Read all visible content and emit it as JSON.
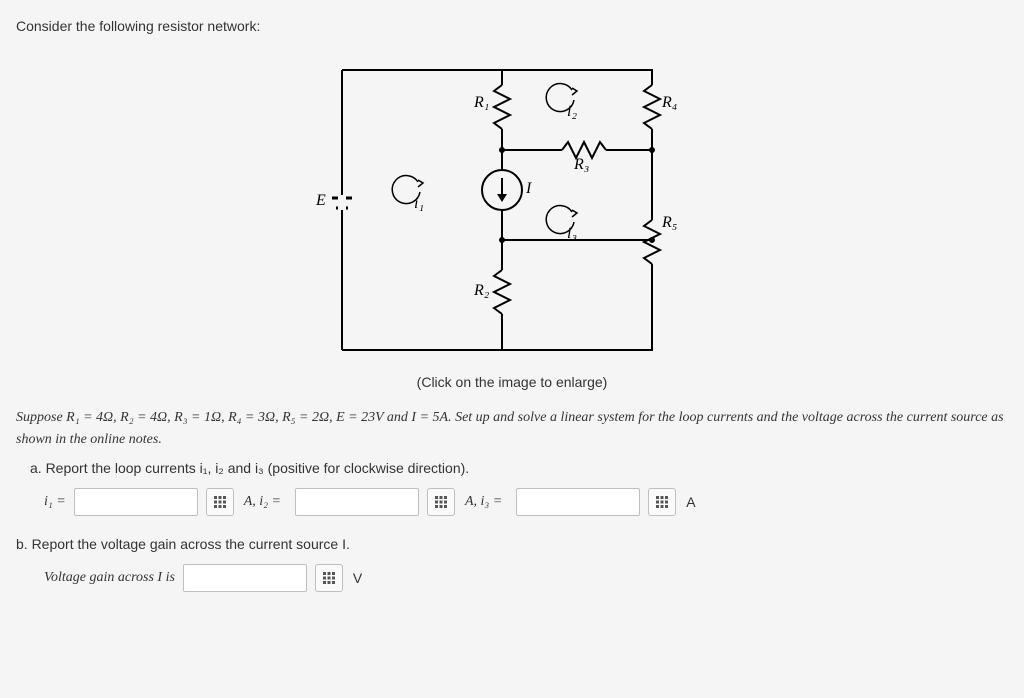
{
  "intro": "Consider the following resistor network:",
  "diagram": {
    "E": "E",
    "i1": "i₁",
    "I": "I",
    "R1": "R₁",
    "R2": "R₂",
    "R3": "R₃",
    "R4": "R₄",
    "R5": "R₅",
    "i2": "i₂",
    "i3": "i₃"
  },
  "enlarge": "(Click on the image to enlarge)",
  "suppose_sentence": "Suppose R₁ = 4Ω, R₂ = 4Ω, R₃ = 1Ω, R₄ = 3Ω, R₅ = 2Ω, E = 23V and I = 5A. Set up and solve a linear system for the loop currents and the voltage across the current source as shown in the online notes.",
  "part_a": "a. Report the loop currents i₁, i₂ and i₃ (positive for clockwise direction).",
  "answers_a": {
    "i1_label": "i₁ =",
    "i2_label": "A, i₂ =",
    "i3_label": "A, i₃ =",
    "end_unit": "A"
  },
  "part_b": "b. Report the voltage gain across the current source I.",
  "answers_b": {
    "label": "Voltage gain across I is",
    "unit": "V"
  },
  "values": {
    "R1_ohm": 4,
    "R2_ohm": 4,
    "R3_ohm": 1,
    "R4_ohm": 3,
    "R5_ohm": 2,
    "E_volts": 23,
    "I_amps": 5
  }
}
